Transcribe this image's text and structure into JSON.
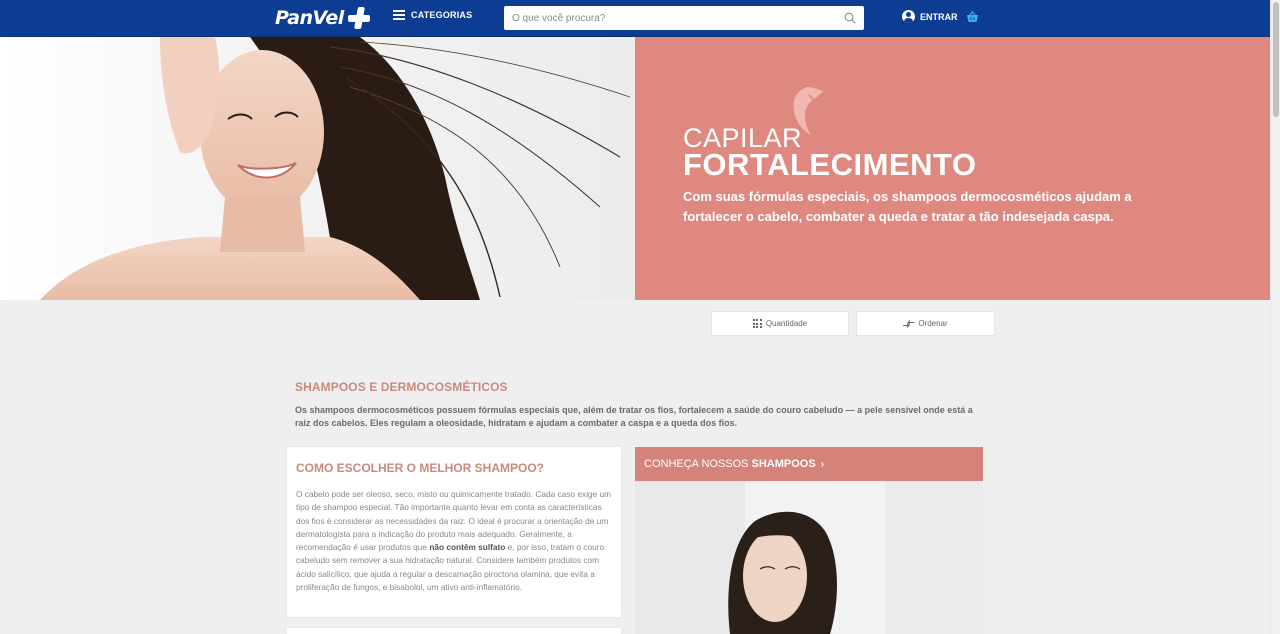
{
  "header": {
    "logo_text": "PanVel",
    "categories_label": "CATEGORIAS",
    "search_placeholder": "O que você procura?",
    "login_label": "ENTRAR",
    "brand_color": "#0c3d93",
    "icons": [
      "menu-icon",
      "search-icon",
      "user-icon",
      "cart-icon"
    ]
  },
  "banner": {
    "kicker": "CAPILAR",
    "title": "FORTALECIMENTO",
    "description": "Com suas fórmulas especiais, os shampoos dermocosméticos ajudam a fortalecer o cabelo, combater a queda e tratar a tão indesejada caspa.",
    "panel_color": "#de8880"
  },
  "toolbar": {
    "quantity_label": "Quantidade",
    "sort_label": "Ordenar"
  },
  "section": {
    "title": "SHAMPOOS E DERMOCOSMÉTICOS",
    "description": "Os shampoos dermocosméticos possuem fórmulas especiais que, além de tratar os fios, fortalecem a saúde do couro cabeludo — a pele sensível onde está a raiz dos cabelos. Eles regulam a oleosidade, hidratam e ajudam a combater a caspa e a queda dos fios.",
    "accent_color": "#c98a7e"
  },
  "how_to_choose": {
    "title": "COMO ESCOLHER O MELHOR SHAMPOO?",
    "text_before_bold": "O cabelo pode ser oleoso, seco, misto ou quimicamente tratado. Cada caso exige um tipo de shampoo especial. Tão importante quanto levar em conta as características dos fios é considerar as necessidades da raiz. O ideal é procurar a orientação de um dermatologista para a indicação do produto mais adequado. Geralmente, a recomendação é usar produtos que ",
    "text_bold": "não contêm sulfato",
    "text_after_bold": " e, por isso, tratam o couro cabeludo sem remover a sua hidratação natural. Considere também produtos com ácido salicílico, que ajuda a regular a descamação piroctona olamina, que evita a proliferação de fungos, e bisabolol, um ativo anti-inflamatório."
  },
  "shampoo_link": {
    "prefix": "CONHEÇA NOSSOS",
    "strong": "SHAMPOOS",
    "chevron": "›"
  }
}
